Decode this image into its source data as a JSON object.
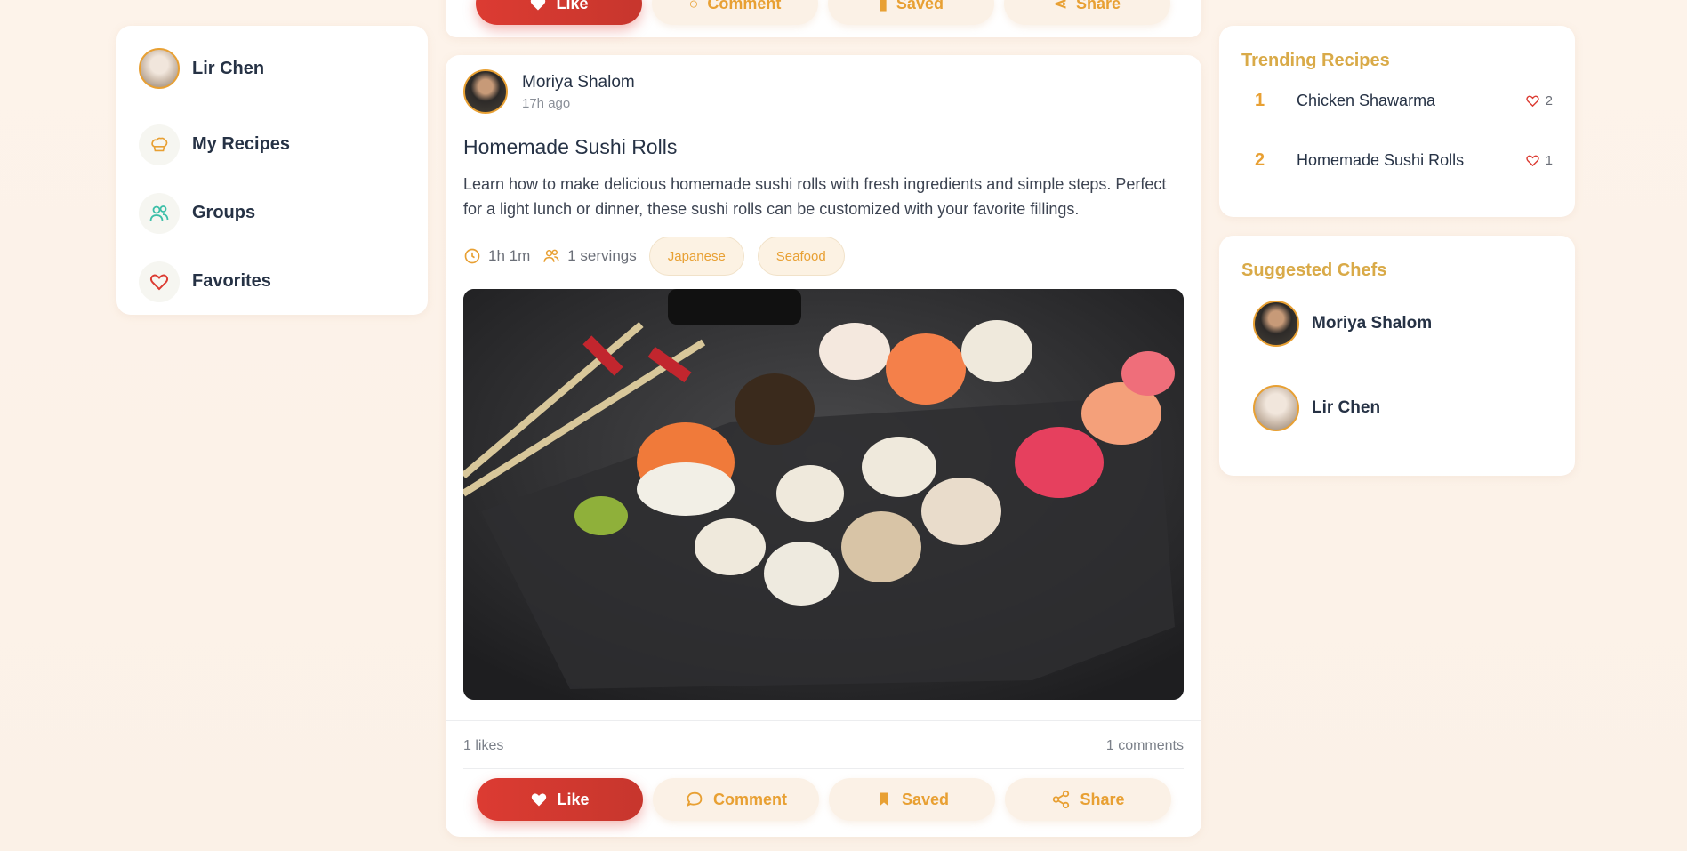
{
  "colors": {
    "accent": "#e8a033",
    "like": "#dc3b32",
    "heading": "#d9aa48",
    "text": "#263245"
  },
  "sidebar": {
    "items": [
      {
        "label": "Lir Chen",
        "icon": "avatar"
      },
      {
        "label": "My Recipes",
        "icon": "chef-hat-icon"
      },
      {
        "label": "Groups",
        "icon": "users-icon"
      },
      {
        "label": "Favorites",
        "icon": "heart-icon"
      }
    ]
  },
  "top_actions": {
    "like": "Like",
    "comment": "Comment",
    "saved": "Saved",
    "share": "Share"
  },
  "post": {
    "author": "Moriya Shalom",
    "time": "17h ago",
    "title": "Homemade Sushi Rolls",
    "description": "Learn how to make delicious homemade sushi rolls with fresh ingredients and simple steps. Perfect for a light lunch or dinner, these sushi rolls can be customized with your favorite fillings.",
    "duration": "1h 1m",
    "servings": "1 servings",
    "tags": [
      "Japanese",
      "Seafood"
    ],
    "likes": "1 likes",
    "comments": "1 comments",
    "actions": {
      "like": "Like",
      "comment": "Comment",
      "saved": "Saved",
      "share": "Share"
    }
  },
  "trending": {
    "title": "Trending Recipes",
    "items": [
      {
        "rank": "1",
        "name": "Chicken Shawarma",
        "likes": "2"
      },
      {
        "rank": "2",
        "name": "Homemade Sushi Rolls",
        "likes": "1"
      }
    ]
  },
  "chefs": {
    "title": "Suggested Chefs",
    "items": [
      {
        "name": "Moriya Shalom"
      },
      {
        "name": "Lir Chen"
      }
    ]
  }
}
